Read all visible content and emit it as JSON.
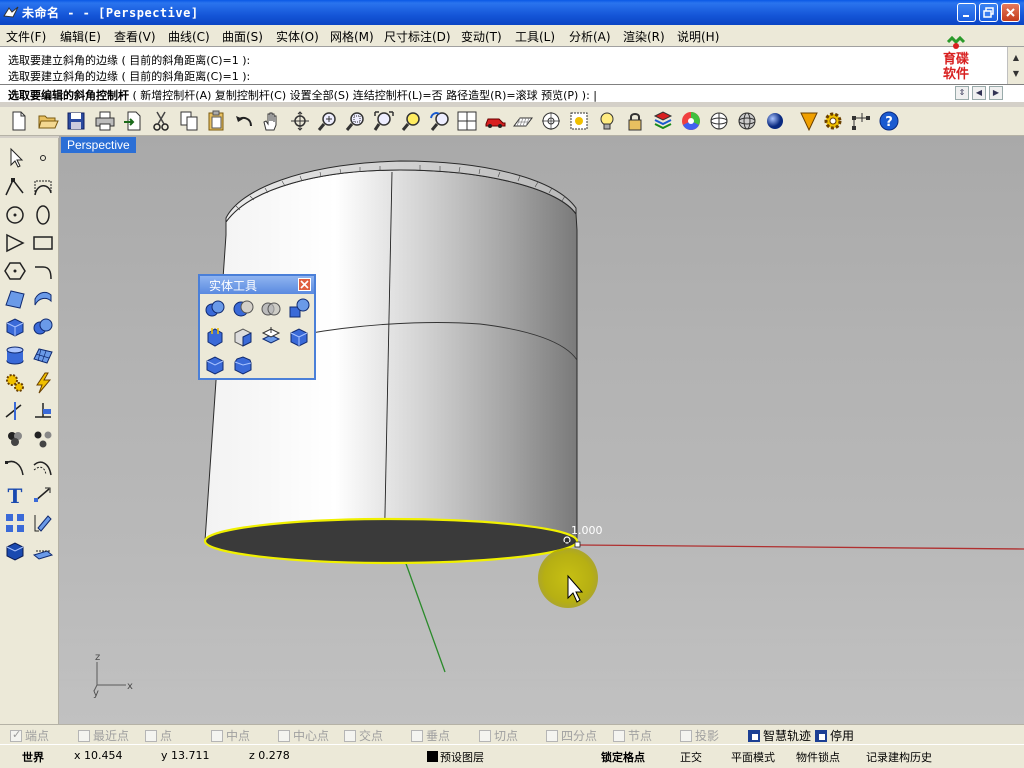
{
  "window": {
    "title": "未命名 - - [Perspective]"
  },
  "menu": [
    "文件(F)",
    "编辑(E)",
    "查看(V)",
    "曲线(C)",
    "曲面(S)",
    "实体(O)",
    "网格(M)",
    "尺寸标注(D)",
    "变动(T)",
    "工具(L)",
    "分析(A)",
    "渲染(R)",
    "说明(H)"
  ],
  "command": {
    "history": [
      "选取要建立斜角的边缘 ( 目前的斜角距离(C)=1 ):",
      "选取要建立斜角的边缘 ( 目前的斜角距离(C)=1 ):"
    ],
    "prompt_bold": "选取要编辑的斜角控制杆",
    "prompt_rest": " ( 新增控制杆(A)  复制控制杆(C)  设置全部(S)  连结控制杆(L)=否  路径造型(R)=滚球  预览(P) ): |"
  },
  "logo": {
    "line1": "育碟",
    "line2": "软件"
  },
  "viewport": {
    "name": "Perspective",
    "handle_value": "1.000",
    "axis_z": "z",
    "axis_y": "y",
    "axis_x": "x"
  },
  "palette": {
    "title": "实体工具"
  },
  "osnap": [
    {
      "label": "端点",
      "checked": true,
      "active": false
    },
    {
      "label": "最近点",
      "checked": false,
      "active": false
    },
    {
      "label": "点",
      "checked": false,
      "active": false
    },
    {
      "label": "中点",
      "checked": false,
      "active": false
    },
    {
      "label": "中心点",
      "checked": false,
      "active": false
    },
    {
      "label": "交点",
      "checked": false,
      "active": false
    },
    {
      "label": "垂点",
      "checked": false,
      "active": false
    },
    {
      "label": "切点",
      "checked": false,
      "active": false
    },
    {
      "label": "四分点",
      "checked": false,
      "active": false
    },
    {
      "label": "节点",
      "checked": false,
      "active": false
    },
    {
      "label": "投影",
      "checked": false,
      "active": false
    },
    {
      "label": "智慧轨迹",
      "checked": false,
      "active": true
    },
    {
      "label": "停用",
      "checked": false,
      "active": true
    }
  ],
  "status": {
    "cplane": "世界",
    "x": "x 10.454",
    "y": "y 13.711",
    "z": "z 0.278",
    "layer": "预设图层",
    "grid_snap": "锁定格点",
    "ortho": "正交",
    "planar": "平面模式",
    "osnap": "物件锁点",
    "history": "记录建构历史"
  },
  "colors": {
    "title_bar": "#0a58e6",
    "viewport_label": "#2b6fd6",
    "edge_highlight": "#f0f000",
    "x_axis": "#b03030",
    "y_axis": "#2a8a2a"
  }
}
